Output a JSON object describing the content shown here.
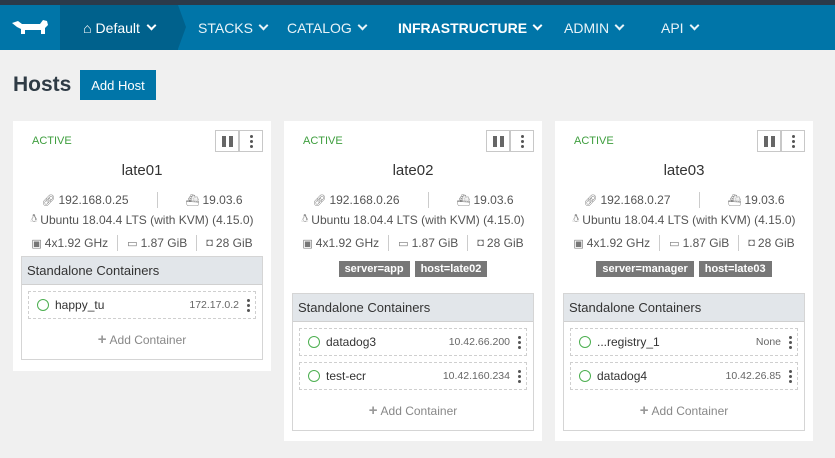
{
  "nav": {
    "environment": "Default",
    "items": [
      "STACKS",
      "CATALOG",
      "INFRASTRUCTURE",
      "ADMIN",
      "API"
    ],
    "active": "INFRASTRUCTURE",
    "colors": {
      "bar": "#0075a8",
      "env": "#00618c"
    }
  },
  "page": {
    "title": "Hosts",
    "add_button": "Add Host"
  },
  "common": {
    "section_title": "Standalone Containers",
    "add_container": "Add Container"
  },
  "hosts": [
    {
      "state": "ACTIVE",
      "name": "late01",
      "ip": "192.168.0.25",
      "docker": "19.03.6",
      "os": "Ubuntu 18.04.4 LTS (with KVM) (4.15.0)",
      "cpu": "4x1.92 GHz",
      "memory": "1.87 GiB",
      "disk": "28 GiB",
      "labels": [],
      "containers": [
        {
          "name": "happy_tu",
          "ip": "172.17.0.2"
        }
      ]
    },
    {
      "state": "ACTIVE",
      "name": "late02",
      "ip": "192.168.0.26",
      "docker": "19.03.6",
      "os": "Ubuntu 18.04.4 LTS (with KVM) (4.15.0)",
      "cpu": "4x1.92 GHz",
      "memory": "1.87 GiB",
      "disk": "28 GiB",
      "labels": [
        "server=app",
        "host=late02"
      ],
      "containers": [
        {
          "name": "datadog3",
          "ip": "10.42.66.200"
        },
        {
          "name": "test-ecr",
          "ip": "10.42.160.234"
        }
      ]
    },
    {
      "state": "ACTIVE",
      "name": "late03",
      "ip": "192.168.0.27",
      "docker": "19.03.6",
      "os": "Ubuntu 18.04.4 LTS (with KVM) (4.15.0)",
      "cpu": "4x1.92 GHz",
      "memory": "1.87 GiB",
      "disk": "28 GiB",
      "labels": [
        "server=manager",
        "host=late03"
      ],
      "containers": [
        {
          "name": "...registry_1",
          "ip": "None"
        },
        {
          "name": "datadog4",
          "ip": "10.42.26.85"
        }
      ]
    }
  ]
}
